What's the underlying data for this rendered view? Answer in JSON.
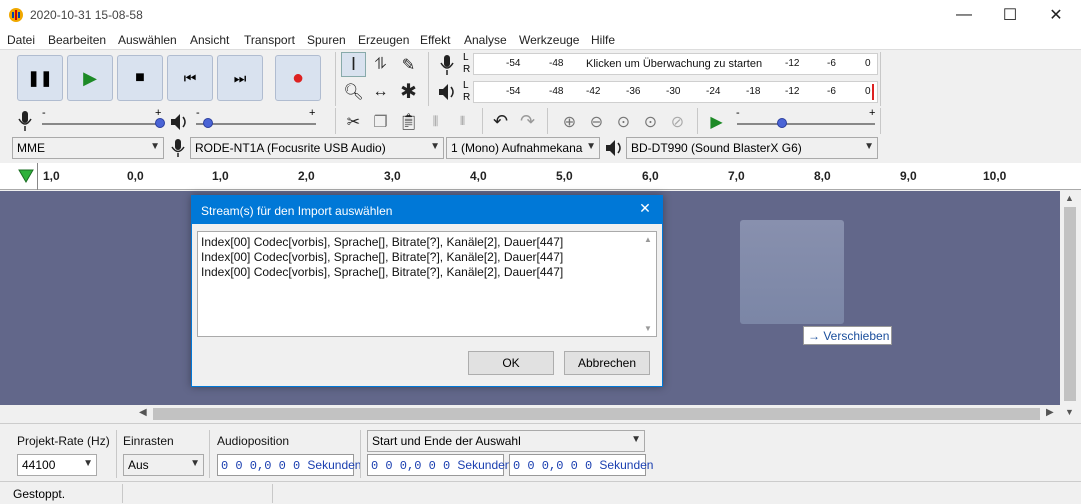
{
  "window": {
    "title": "2020-10-31 15-08-58",
    "minimize": "—",
    "maximize": "☐",
    "close": "✕"
  },
  "menu": [
    "Datei",
    "Bearbeiten",
    "Auswählen",
    "Ansicht",
    "Transport",
    "Spuren",
    "Erzeugen",
    "Effekt",
    "Analyse",
    "Werkzeuge",
    "Hilfe"
  ],
  "transport": {
    "pause": "❚❚",
    "play": "▶",
    "stop": "■",
    "skip_start": "⏮",
    "skip_end": "⏭",
    "record": "●"
  },
  "meters": {
    "record_ticks": [
      "-54",
      "-48",
      "-12",
      "-6",
      "0"
    ],
    "record_message": "Klicken um Überwachung zu starten",
    "play_ticks": [
      "-54",
      "-48",
      "-42",
      "-36",
      "-30",
      "-24",
      "-18",
      "-12",
      "-6",
      "0"
    ],
    "channel_l": "L",
    "channel_r": "R"
  },
  "sliders": {
    "min": "-",
    "max": "+"
  },
  "devices": {
    "host": "MME",
    "input": "RODE-NT1A (Focusrite USB Audio)",
    "channels": "1 (Mono) Aufnahmekana",
    "output": "BD-DT990 (Sound BlasterX G6)"
  },
  "ruler": [
    "1,0",
    "0,0",
    "1,0",
    "2,0",
    "3,0",
    "4,0",
    "5,0",
    "6,0",
    "7,0",
    "8,0",
    "9,0",
    "10,0"
  ],
  "dialog": {
    "title": "Stream(s) für den Import auswählen",
    "streams": [
      "Index[00] Codec[vorbis], Sprache[], Bitrate[?], Kanäle[2], Dauer[447]",
      "Index[00] Codec[vorbis], Sprache[], Bitrate[?], Kanäle[2], Dauer[447]",
      "Index[00] Codec[vorbis], Sprache[], Bitrate[?], Kanäle[2], Dauer[447]"
    ],
    "ok": "OK",
    "cancel": "Abbrechen"
  },
  "drag_tooltip": "→ Verschieben",
  "bottom": {
    "project_rate_label": "Projekt-Rate (Hz)",
    "project_rate": "44100",
    "snap_label": "Einrasten",
    "snap": "Aus",
    "audio_position_label": "Audioposition",
    "selection_mode": "Start und Ende der Auswahl",
    "time_value": "0 0 0,0 0 0",
    "time_unit": "Sekunden"
  },
  "status": "Gestoppt."
}
